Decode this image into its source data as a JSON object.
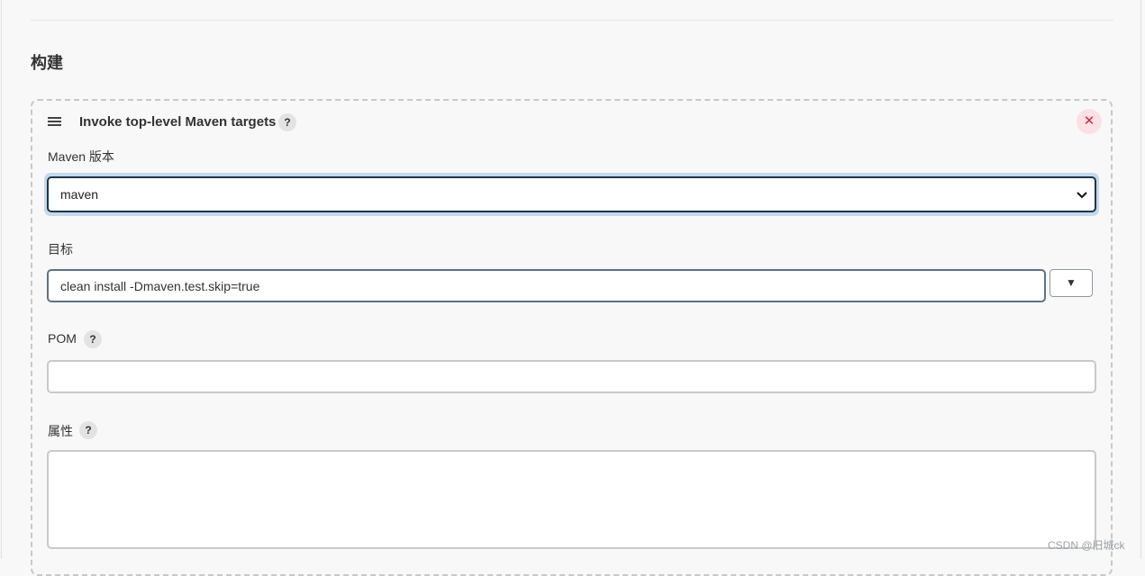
{
  "section": {
    "title": "构建"
  },
  "build_step": {
    "title": "Invoke top-level Maven targets",
    "help_label": "?",
    "delete_label": "✕"
  },
  "fields": {
    "maven_version": {
      "label": "Maven 版本",
      "selected": "maven"
    },
    "goals": {
      "label": "目标",
      "value": "clean  install -Dmaven.test.skip=true",
      "dropdown_label": "▼"
    },
    "pom": {
      "label": "POM",
      "help_label": "?",
      "value": ""
    },
    "properties": {
      "label": "属性",
      "help_label": "?",
      "value": ""
    }
  },
  "watermark": "CSDN @旧城ck",
  "colors": {
    "delete": "#d0273c",
    "focus_border": "#1f3448",
    "focus_ring": "#c5d9ec"
  }
}
